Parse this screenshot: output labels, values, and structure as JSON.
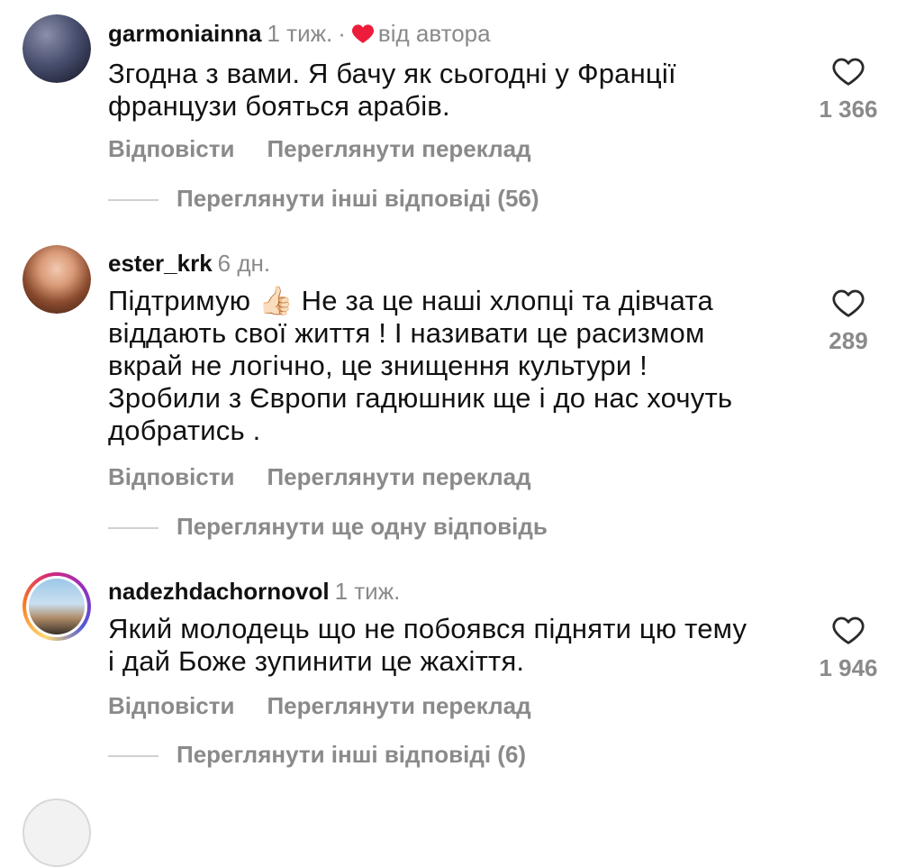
{
  "comments": [
    {
      "username": "garmoniainna",
      "time": "1 тиж.",
      "author_like_label": "від автора",
      "text": "Згодна з вами. Я бачу як сьогодні у Франції французи бояться арабів.",
      "likes": "1 366",
      "reply_label": "Відповісти",
      "translate_label": "Переглянути переклад",
      "more_replies": "Переглянути інші відповіді (56)"
    },
    {
      "username": "ester_krk",
      "time": "6 дн.",
      "text_lines": [
        "Підтримую 👍🏻 Не за це наші хлопці та дівчата",
        "віддають свої життя ! І називати це расизмом",
        "вкрай не логічно, це знищення культури !",
        "Зробили з Європи гадюшник ще і до нас хочуть",
        "добратись ."
      ],
      "likes": "289",
      "reply_label": "Відповісти",
      "translate_label": "Переглянути переклад",
      "more_replies": "Переглянути ще одну відповідь"
    },
    {
      "username": "nadezhdachornovol",
      "time": "1 тиж.",
      "text_lines": [
        "Який молодець що не побоявся підняти цю тему",
        "і дай Боже зупинити це жахіття."
      ],
      "likes": "1 946",
      "reply_label": "Відповісти",
      "translate_label": "Переглянути переклад",
      "more_replies": "Переглянути інші відповіді (6)"
    }
  ],
  "colors": {
    "heart_red": "#ed1c3a",
    "muted": "#8a8a8a",
    "text": "#111111"
  },
  "icons": {
    "like": "heart-outline-icon",
    "author_like": "heart-filled-icon"
  }
}
